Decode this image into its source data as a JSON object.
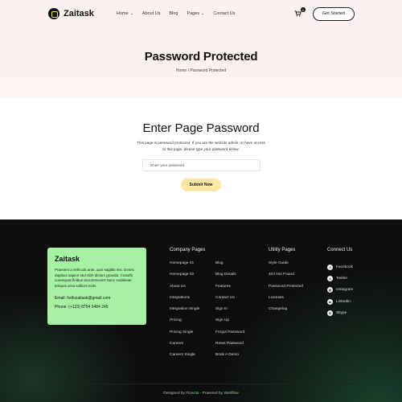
{
  "header": {
    "brand": "Zaitask",
    "menu": [
      {
        "label": "Home",
        "dropdown": true
      },
      {
        "label": "About Us",
        "dropdown": false
      },
      {
        "label": "Blog",
        "dropdown": false
      },
      {
        "label": "Pages",
        "dropdown": true
      },
      {
        "label": "Contact Us",
        "dropdown": false
      }
    ],
    "cart_count": "0",
    "cta_label": "Get Started"
  },
  "hero": {
    "title": "Password Protected",
    "breadcrumb": "Home / Password Protected"
  },
  "main": {
    "title": "Enter Page Password",
    "description": "This page is password protected. If you are the website admin, or have access to this page, please type your password below.",
    "input_placeholder": "Enter your password",
    "input_value": "",
    "submit_label": "Submit Now"
  },
  "footer": {
    "card": {
      "title": "Zaitask",
      "description": "Praesent a vehicula ante, quis sagittis nisi. Donec dapibus sapien sed nibh dictum gravida. Crasdfs consequat finibus accummsnert Nunc sodaleser tempus urna sollicet issits.",
      "email": "Email: hellozaitask@gmail.com",
      "phone": "Phone: (+123) 8754 5484 245"
    },
    "company_title": "Company Pages",
    "company_col1": [
      "Homepage 01",
      "Homepage 02",
      "About Us",
      "Integrations",
      "Integration Single",
      "Pricing",
      "Pricing Single",
      "Careers",
      "Careers Single"
    ],
    "company_col2": [
      "Blog",
      "Blog Details",
      "Features",
      "Contact Us",
      "Sign In",
      "Sign Up",
      "Forgot Password",
      "Reset Password",
      "Book A Demo"
    ],
    "utility_title": "Utility Pages",
    "utility": [
      "Style Guide",
      "404 Not Found",
      "Password Protected",
      "Licenses",
      "Changelog"
    ],
    "connect_title": "Connect Us",
    "social": [
      {
        "label": "Facebook",
        "icon": "facebook-icon",
        "glyph": "f"
      },
      {
        "label": "Twitter",
        "icon": "twitter-icon",
        "glyph": "t"
      },
      {
        "label": "Instagram",
        "icon": "instagram-icon",
        "glyph": "◎"
      },
      {
        "label": "Linkedin",
        "icon": "linkedin-icon",
        "glyph": "in"
      },
      {
        "label": "Skype",
        "icon": "skype-icon",
        "glyph": "S"
      }
    ],
    "copyright_prefix": "Designed by ",
    "copyright_designer": "Flowzai",
    "copyright_mid": " - Powered by ",
    "copyright_platform": "Webflow"
  },
  "colors": {
    "card_bg": "#a6f1a4",
    "submit_bg": "#fde7a5",
    "accent_green": "#7ee27a"
  }
}
